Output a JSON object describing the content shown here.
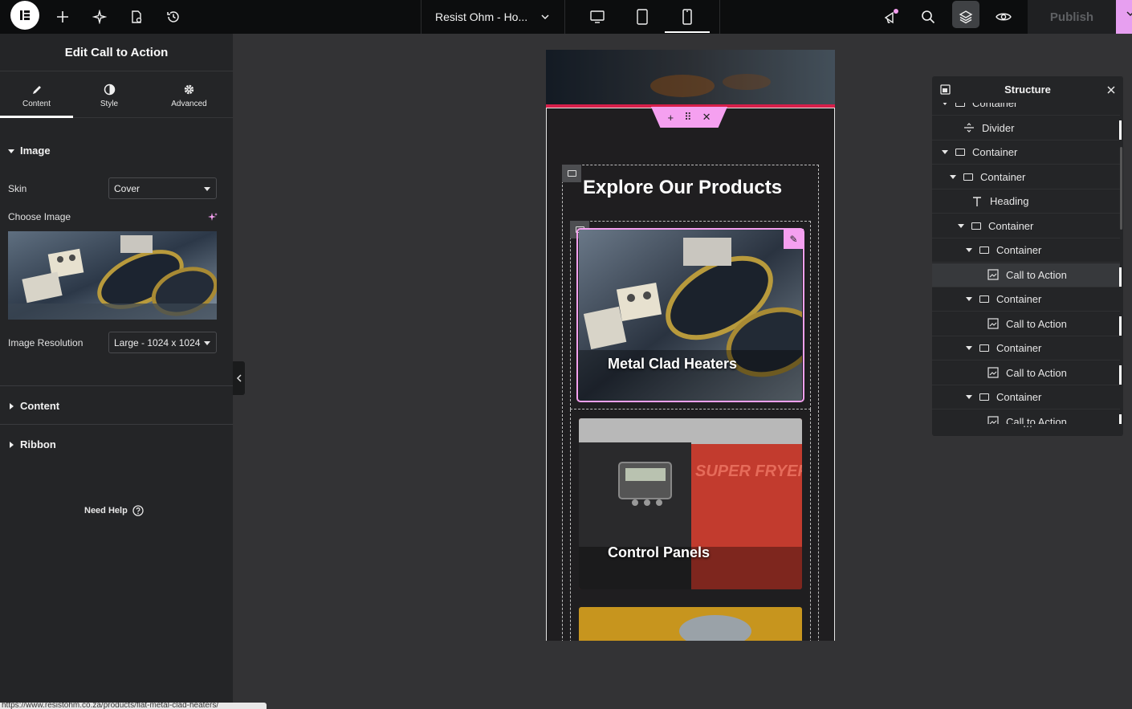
{
  "topbar": {
    "page_title": "Resist Ohm - Ho...",
    "publish_label": "Publish"
  },
  "panel": {
    "title": "Edit Call to Action",
    "tabs": [
      {
        "label": "Content",
        "icon": "pencil-icon",
        "active": true
      },
      {
        "label": "Style",
        "icon": "half-circle-icon",
        "active": false
      },
      {
        "label": "Advanced",
        "icon": "gear-icon",
        "active": false
      }
    ],
    "image_section": {
      "title": "Image",
      "skin_label": "Skin",
      "skin_value": "Cover",
      "choose_image_label": "Choose Image",
      "resolution_label": "Image Resolution",
      "resolution_value": "Large - 1024 x 1024"
    },
    "content_section": "Content",
    "ribbon_section": "Ribbon",
    "need_help": "Need Help",
    "status_url": "https://www.resistohm.co.za/products/flat-metal-clad-heaters/"
  },
  "canvas": {
    "heading": "Explore Our Products",
    "cards": [
      {
        "title": "Metal Clad Heaters"
      },
      {
        "title": "Control Panels"
      }
    ],
    "accent_color": "#f5a0f0"
  },
  "structure": {
    "title": "Structure",
    "rows": [
      {
        "label": "Container",
        "type": "container",
        "depth": 0,
        "arrow": true
      },
      {
        "label": "Divider",
        "type": "divider",
        "depth": 1,
        "arrow": false,
        "mark": true
      },
      {
        "label": "Container",
        "type": "container",
        "depth": 0,
        "arrow": true
      },
      {
        "label": "Container",
        "type": "container",
        "depth": 1,
        "arrow": true
      },
      {
        "label": "Heading",
        "type": "heading",
        "depth": 2,
        "arrow": false
      },
      {
        "label": "Container",
        "type": "container",
        "depth": 2,
        "arrow": true
      },
      {
        "label": "Container",
        "type": "container",
        "depth": 3,
        "arrow": true
      },
      {
        "label": "Call to Action",
        "type": "cta",
        "depth": 4,
        "arrow": false,
        "selected": true,
        "mark": true
      },
      {
        "label": "Container",
        "type": "container",
        "depth": 3,
        "arrow": true
      },
      {
        "label": "Call to Action",
        "type": "cta",
        "depth": 4,
        "arrow": false,
        "mark": true
      },
      {
        "label": "Container",
        "type": "container",
        "depth": 3,
        "arrow": true
      },
      {
        "label": "Call to Action",
        "type": "cta",
        "depth": 4,
        "arrow": false,
        "mark": true
      },
      {
        "label": "Container",
        "type": "container",
        "depth": 3,
        "arrow": true
      },
      {
        "label": "Call to Action",
        "type": "cta",
        "depth": 4,
        "arrow": false,
        "mark": true
      }
    ]
  }
}
